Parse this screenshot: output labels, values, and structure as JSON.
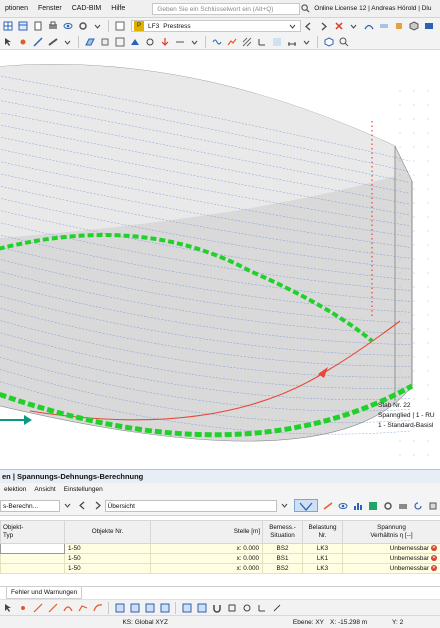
{
  "menubar": {
    "items": [
      "ptionen",
      "Fenster",
      "CAD-BIM",
      "Hilfe"
    ],
    "search_placeholder": "Geben Sie ein Schlüsselwort ein (Alt+Q)",
    "license": "Online License 12 | Andreas Hörold | Dlu"
  },
  "toolbar": {
    "load_badge": "P",
    "load_code": "LF3",
    "load_name": "Prestress"
  },
  "tooltip": {
    "line1": "Stab Nr. 22",
    "line2": "Spannglied | 1 - RU",
    "line3": "1 - Standard-Basisl"
  },
  "panel": {
    "title": "en | Spannungs-Dehnungs-Berechnung",
    "menu": [
      "elektion",
      "Ansicht",
      "Einstellungen"
    ],
    "combo_left": "s-Berechn...",
    "combo_overview": "Übersicht"
  },
  "table": {
    "headers": [
      "Objekt-\nTyp",
      "Objekte Nr.",
      "Stelle [m]",
      "Bemess.-\nSituation",
      "Belastung\nNr.",
      "Spannung\nVerhältnis η [--]"
    ],
    "rows": [
      {
        "objects": "1-50",
        "location": "x: 0.000",
        "situation": "BS2",
        "load": "LK3",
        "ratio": "Unbemessbar"
      },
      {
        "objects": "1-50",
        "location": "x: 0.000",
        "situation": "BS1",
        "load": "LK1",
        "ratio": "Unbemessbar"
      },
      {
        "objects": "1-50",
        "location": "x: 0.000",
        "situation": "BS2",
        "load": "LK3",
        "ratio": "Unbemessbar"
      }
    ]
  },
  "tabs": {
    "errors": "Fehler und Warnungen"
  },
  "status": {
    "ks": "KS: Global XYZ",
    "plane": "Ebene: XY",
    "x": "X: -15.298 m",
    "y": "Y: 2"
  },
  "colors": {
    "green": "#22d02c",
    "red": "#e8473a",
    "surface": "#d9d9d9",
    "teal": "#0a9a7f"
  }
}
